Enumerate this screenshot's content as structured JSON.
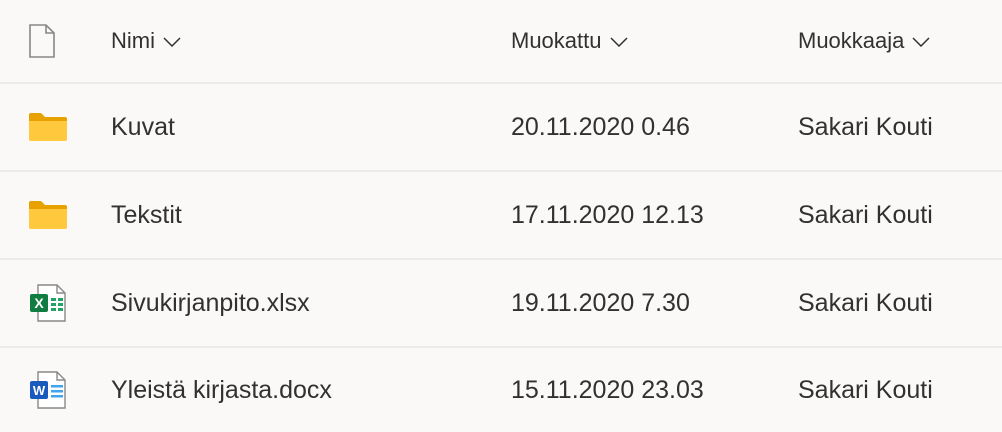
{
  "columns": {
    "file_type": "file-type-icon",
    "name": "Nimi",
    "modified": "Muokattu",
    "modified_by": "Muokkaaja"
  },
  "rows": [
    {
      "icon": "folder-icon",
      "name": "Kuvat",
      "modified": "20.11.2020 0.46",
      "modified_by": "Sakari Kouti"
    },
    {
      "icon": "folder-icon",
      "name": "Tekstit",
      "modified": "17.11.2020 12.13",
      "modified_by": "Sakari Kouti"
    },
    {
      "icon": "excel-file-icon",
      "name": "Sivukirjanpito.xlsx",
      "modified": "19.11.2020 7.30",
      "modified_by": "Sakari Kouti"
    },
    {
      "icon": "word-file-icon",
      "name": "Yleistä kirjasta.docx",
      "modified": "15.11.2020 23.03",
      "modified_by": "Sakari Kouti"
    }
  ],
  "colors": {
    "background": "#faf9f8",
    "divider": "#edebe9",
    "text": "#323130",
    "folder": "#ffb900",
    "excel": "#107c41",
    "word": "#185abd"
  }
}
